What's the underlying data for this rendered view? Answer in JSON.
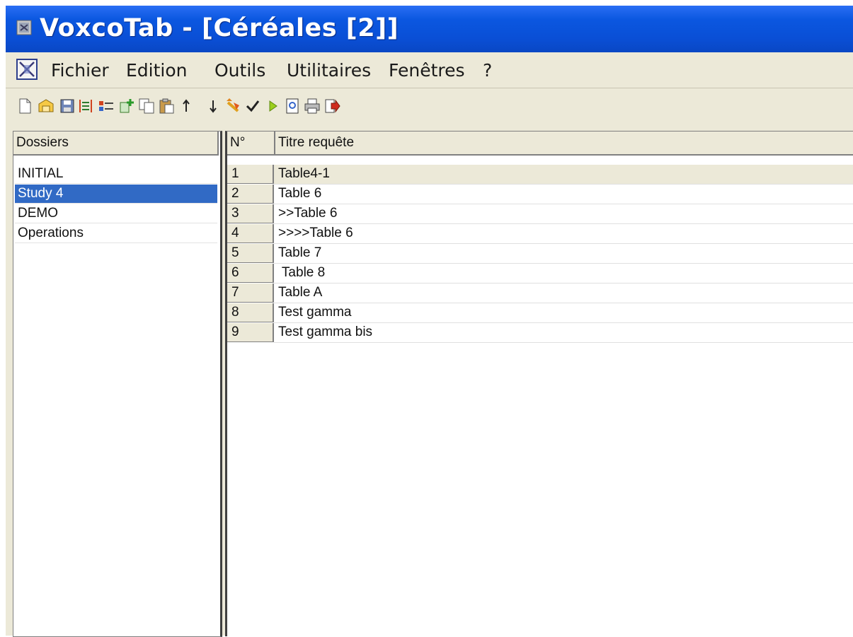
{
  "window": {
    "title": "VoxcoTab - [Céréales [2]]"
  },
  "menu": [
    "Fichier",
    "Edition",
    "Outils",
    "Utilitaires",
    "Fenêtres",
    "?"
  ],
  "toolbar": [
    "new-doc-icon",
    "open-folder-icon",
    "save-icon",
    "columns-icon",
    "list-icon",
    "add-icon",
    "copy-icon",
    "paste-icon",
    "arrow-up-icon",
    "arrow-down-icon",
    "undo-icon",
    "check-icon",
    "run-icon",
    "preview-icon",
    "print-icon",
    "exit-icon"
  ],
  "folders": {
    "header": "Dossiers",
    "items": [
      "INITIAL",
      "Study 4",
      "DEMO",
      "Operations"
    ],
    "selected": "Study 4"
  },
  "queries": {
    "col_num": "N°",
    "col_title": "Titre requête",
    "rows": [
      {
        "n": "1",
        "title": "Table4-1"
      },
      {
        "n": "2",
        "title": "Table 6"
      },
      {
        "n": "3",
        "title": ">>Table 6"
      },
      {
        "n": "4",
        "title": ">>>>Table 6"
      },
      {
        "n": "5",
        "title": "Table 7"
      },
      {
        "n": "6",
        "title": " Table 8"
      },
      {
        "n": "7",
        "title": "Table A"
      },
      {
        "n": "8",
        "title": "Test gamma"
      },
      {
        "n": "9",
        "title": "Test gamma bis"
      }
    ]
  },
  "colors": {
    "title_bar": "#0a4fd6",
    "selection": "#316ac5",
    "face": "#ece9d8"
  }
}
